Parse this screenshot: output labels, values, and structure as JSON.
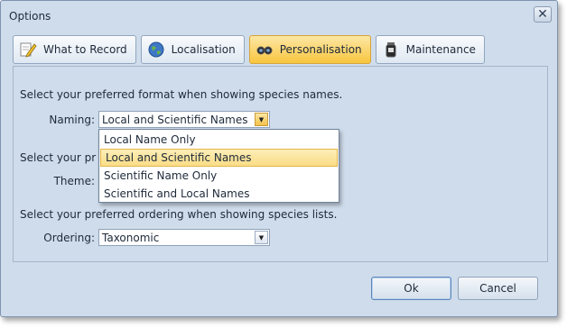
{
  "window": {
    "title": "Options"
  },
  "tabs": [
    {
      "label": "What to Record",
      "icon": "pencil-icon",
      "active": false
    },
    {
      "label": "Localisation",
      "icon": "globe-icon",
      "active": false
    },
    {
      "label": "Personalisation",
      "icon": "binoculars-icon",
      "active": true
    },
    {
      "label": "Maintenance",
      "icon": "jar-icon",
      "active": false
    }
  ],
  "naming": {
    "prompt": "Select your preferred format when showing species names.",
    "label": "Naming:",
    "value": "Local and Scientific Names",
    "options": [
      "Local Name Only",
      "Local and Scientific Names",
      "Scientific Name Only",
      "Scientific and Local Names"
    ],
    "selected_index": 1
  },
  "theme": {
    "prompt": "Select your pr",
    "label": "Theme:"
  },
  "ordering": {
    "prompt": "Select your preferred ordering when showing species lists.",
    "label": "Ordering:",
    "value": "Taxonomic"
  },
  "buttons": {
    "ok": "Ok",
    "cancel": "Cancel"
  },
  "colors": {
    "accent": "#f8c63f",
    "background": "#cfdceb"
  }
}
